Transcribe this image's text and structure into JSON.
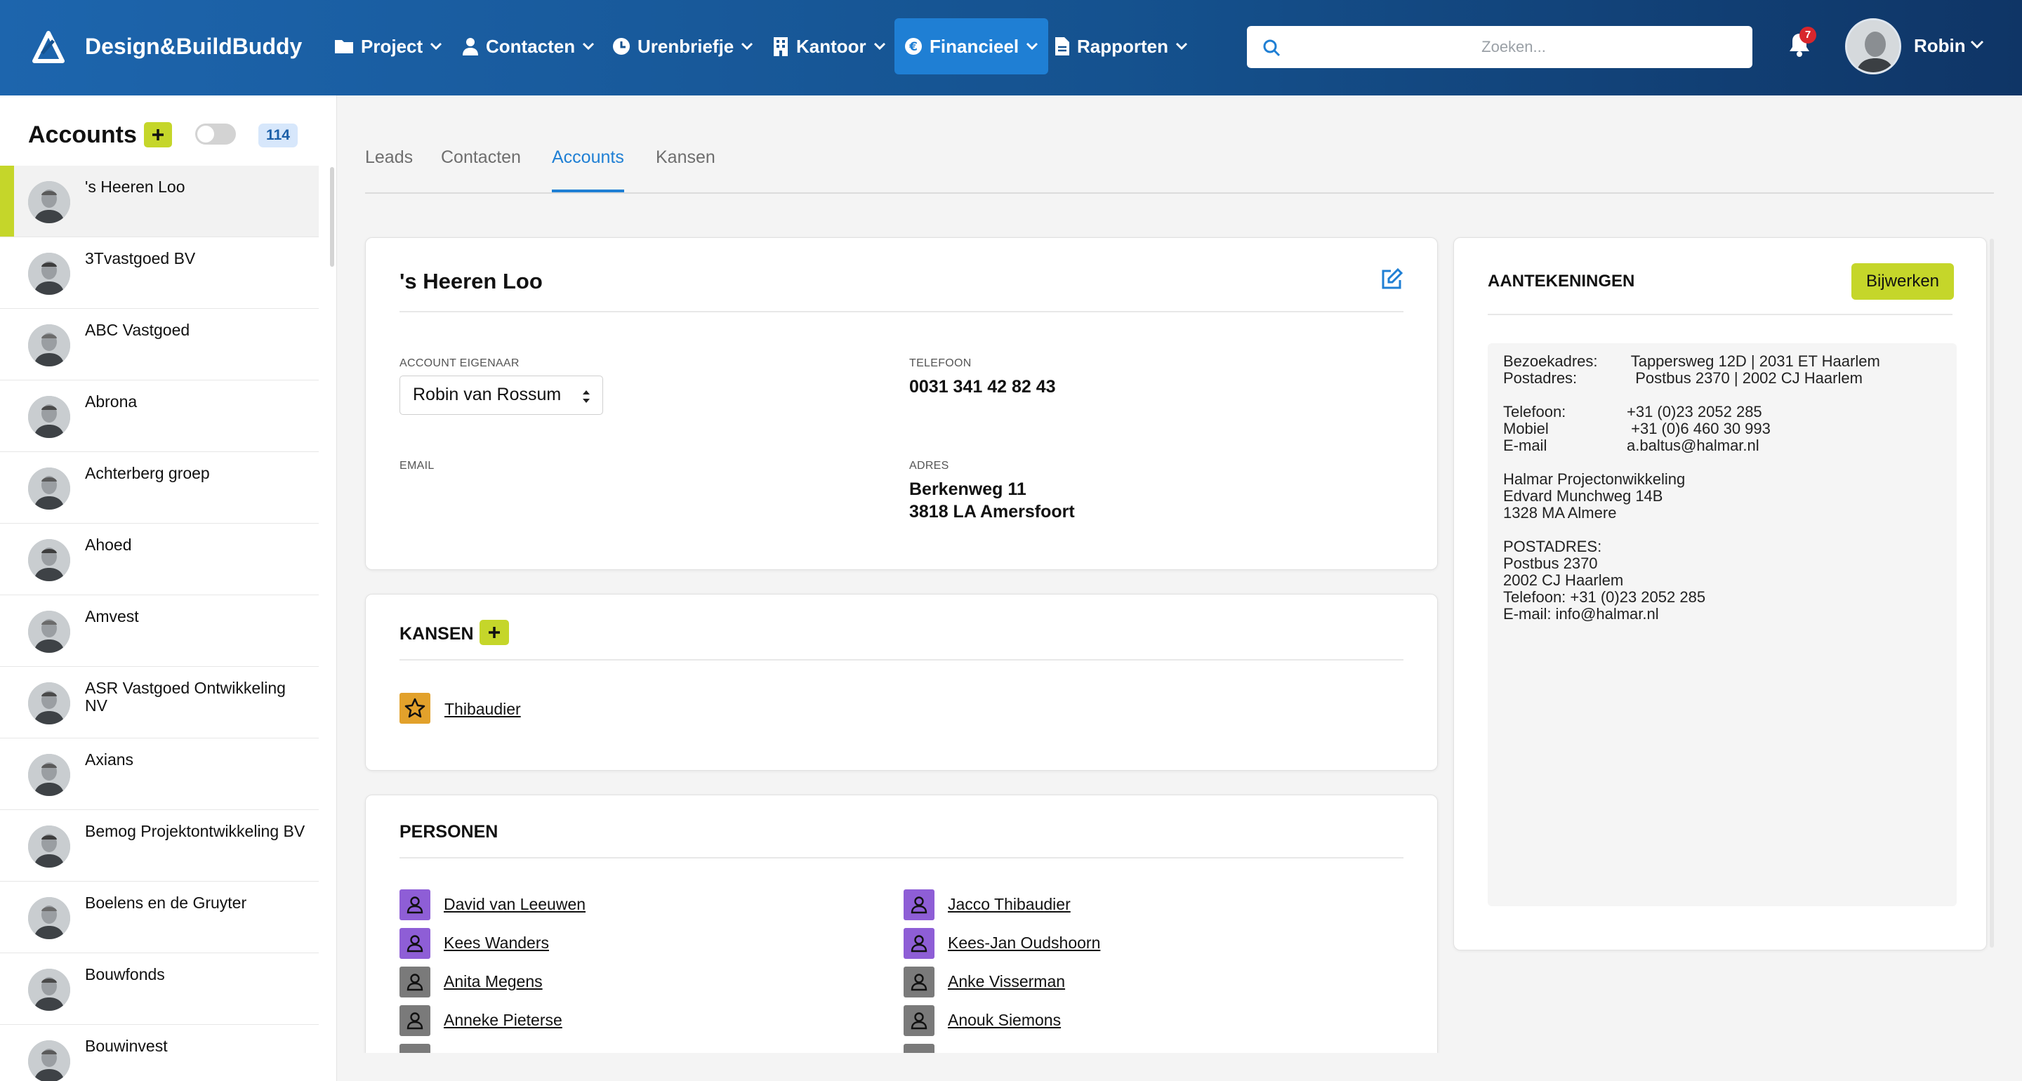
{
  "app": {
    "brand": "Design&BuildBuddy",
    "colors": {
      "accent": "#1f7fd4",
      "lime": "#c5d62a",
      "header": "#15528f"
    }
  },
  "nav": {
    "items": [
      {
        "label": "Project",
        "icon": "folder-icon"
      },
      {
        "label": "Contacten",
        "icon": "user-icon"
      },
      {
        "label": "Urenbriefje",
        "icon": "clock-icon"
      },
      {
        "label": "Kantoor",
        "icon": "building-icon"
      },
      {
        "label": "Financieel",
        "icon": "euro-icon",
        "active": true
      },
      {
        "label": "Rapporten",
        "icon": "document-icon"
      }
    ]
  },
  "search": {
    "placeholder": "Zoeken..."
  },
  "notifications": {
    "count": "7"
  },
  "user": {
    "name": "Robin"
  },
  "sidebar": {
    "title": "Accounts",
    "count": "114",
    "items": [
      {
        "name": "'s Heeren Loo",
        "selected": true
      },
      {
        "name": "3Tvastgoed BV"
      },
      {
        "name": "ABC Vastgoed"
      },
      {
        "name": "Abrona"
      },
      {
        "name": "Achterberg groep"
      },
      {
        "name": "Ahoed"
      },
      {
        "name": "Amvest"
      },
      {
        "name": "ASR Vastgoed Ontwikkeling NV"
      },
      {
        "name": "Axians"
      },
      {
        "name": "Bemog Projektontwikkeling BV"
      },
      {
        "name": "Boelens en de Gruyter"
      },
      {
        "name": "Bouwfonds"
      },
      {
        "name": "Bouwinvest"
      }
    ]
  },
  "tabs": [
    {
      "label": "Leads"
    },
    {
      "label": "Contacten"
    },
    {
      "label": "Accounts",
      "active": true
    },
    {
      "label": "Kansen"
    }
  ],
  "account": {
    "title": "'s Heeren Loo",
    "owner_label": "ACCOUNT EIGENAAR",
    "owner_value": "Robin van Rossum",
    "phone_label": "TELEFOON",
    "phone_value": "0031 341 42 82 43",
    "email_label": "EMAIL",
    "email_value": "",
    "address_label": "ADRES",
    "address_line1": "Berkenweg 11",
    "address_line2": "3818 LA Amersfoort"
  },
  "kansen": {
    "title": "KANSEN",
    "items": [
      {
        "name": "Thibaudier"
      }
    ]
  },
  "personen": {
    "title": "PERSONEN",
    "left": [
      {
        "name": "David van Leeuwen",
        "color": "purple"
      },
      {
        "name": "Kees Wanders",
        "color": "purple"
      },
      {
        "name": "Anita Megens",
        "color": "grey"
      },
      {
        "name": "Anneke Pieterse",
        "color": "grey"
      }
    ],
    "right": [
      {
        "name": "Jacco Thibaudier",
        "color": "purple"
      },
      {
        "name": "Kees-Jan Oudshoorn",
        "color": "purple"
      },
      {
        "name": "Anke Visserman",
        "color": "grey"
      },
      {
        "name": "Anouk Siemons",
        "color": "grey"
      }
    ]
  },
  "notes": {
    "title": "AANTEKENINGEN",
    "update_label": "Bijwerken",
    "block1": [
      {
        "k": "Bezoekadres:",
        "v": " Tappersweg 12D | 2031 ET Haarlem"
      },
      {
        "k": "Postadres:",
        "v": "  Postbus 2370 | 2002 CJ Haarlem"
      }
    ],
    "block2": [
      {
        "k": "Telefoon:",
        "v": "+31 (0)23 2052 285"
      },
      {
        "k": "Mobiel",
        "v": " +31 (0)6 460 30 993"
      },
      {
        "k": "E-mail",
        "v": "a.baltus@halmar.nl"
      }
    ],
    "block3": [
      "Halmar Projectonwikkeling",
      "Edvard Munchweg 14B",
      "1328 MA Almere"
    ],
    "block4": [
      "POSTADRES:",
      "Postbus 2370",
      "2002 CJ Haarlem",
      "Telefoon: +31 (0)23 2052 285",
      "E-mail: info@halmar.nl"
    ]
  }
}
